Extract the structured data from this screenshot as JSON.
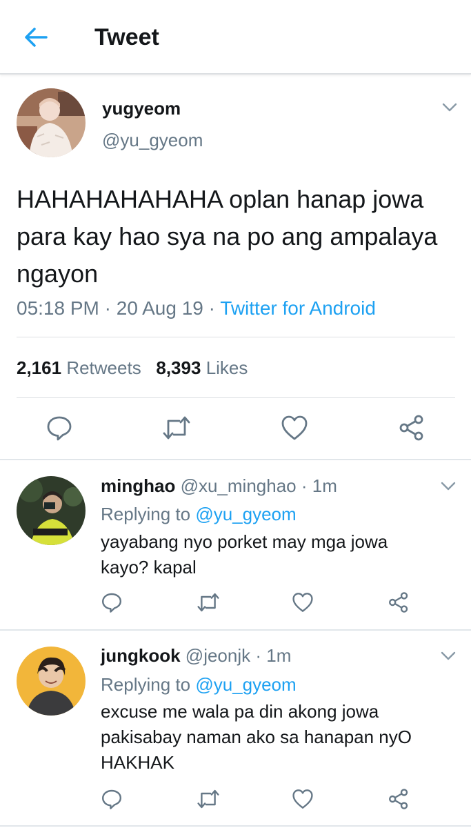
{
  "header": {
    "title": "Tweet"
  },
  "main_tweet": {
    "name": "yugyeom",
    "handle": "@yu_gyeom",
    "text": "HAHAHAHAHAHA oplan hanap jowa para kay hao sya na po ang ampalaya ngayon",
    "time": "05:18 PM",
    "date": "20 Aug 19",
    "source": "Twitter for Android",
    "sep": " · ",
    "retweets_count": "2,161",
    "retweets_label": "Retweets",
    "likes_count": "8,393",
    "likes_label": "Likes"
  },
  "replies": [
    {
      "name": "minghao",
      "handle": "@xu_minghao",
      "time": "1m",
      "replying_label": "Replying to",
      "replying_to": "@yu_gyeom",
      "text": "yayabang nyo porket may mga jowa kayo? kapal"
    },
    {
      "name": "jungkook",
      "handle": "@jeonjk",
      "time": "1m",
      "replying_label": "Replying to",
      "replying_to": "@yu_gyeom",
      "text": "excuse me wala pa din akong jowa pakisabay naman ako sa hanapan nyO HAKHAK"
    }
  ],
  "icons": {
    "back": "arrow-left-icon",
    "reply": "reply-icon",
    "retweet": "retweet-icon",
    "like": "heart-icon",
    "share": "share-icon",
    "menu": "chevron-down-icon"
  },
  "colors": {
    "accent": "#1da1f2",
    "secondary_text": "#657786",
    "primary_text": "#14171a"
  }
}
